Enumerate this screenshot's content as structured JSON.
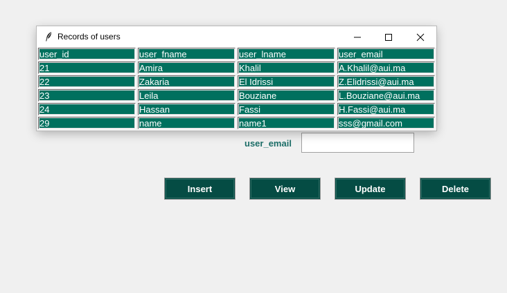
{
  "window": {
    "title": "Records of users",
    "app_icon": "feather-icon"
  },
  "table": {
    "columns": [
      "user_id",
      "user_fname",
      "user_lname",
      "user_email"
    ],
    "rows": [
      [
        "21",
        "Amira",
        "Khalil",
        "A.Khalil@aui.ma"
      ],
      [
        "22",
        "Zakaria",
        "El Idrissi",
        "Z.Elidrissi@aui.ma"
      ],
      [
        "23",
        "Leila",
        "Bouziane",
        "L.Bouziane@aui.ma"
      ],
      [
        "24",
        "Hassan",
        "Fassi",
        "H.Fassi@aui.ma"
      ],
      [
        "29",
        "name",
        "name1",
        "sss@gmail.com"
      ]
    ]
  },
  "form": {
    "email_label": "user_email",
    "email_value": ""
  },
  "buttons": {
    "insert": "Insert",
    "view": "View",
    "update": "Update",
    "delete": "Delete"
  },
  "colors": {
    "cell_bg": "#00705e",
    "button_bg": "#054c44",
    "label_color": "#1d6e68",
    "background": "#f0f0f0"
  }
}
